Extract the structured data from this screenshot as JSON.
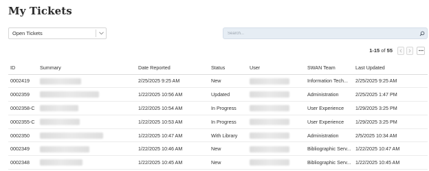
{
  "page": {
    "title": "My Tickets"
  },
  "filter": {
    "selected": "Open Tickets",
    "icon": "chevron-down-icon"
  },
  "search": {
    "placeholder": "Search...",
    "value": "",
    "icon": "search-icon"
  },
  "pager": {
    "range": "1-15",
    "of_word": "of",
    "total": "55"
  },
  "table": {
    "columns": [
      "ID",
      "Summary",
      "Date Reported",
      "Status",
      "User",
      "SWAN Team",
      "Last Updated"
    ],
    "rows": [
      {
        "id": "0002419",
        "date_reported": "2/25/2025 9:25 AM",
        "status": "New",
        "team": "Information Tech...",
        "last_updated": "2/25/2025 9:25 AM"
      },
      {
        "id": "0002359",
        "date_reported": "1/22/2025 10:56 AM",
        "status": "Updated",
        "team": "Administration",
        "last_updated": "2/25/2025 1:47 PM"
      },
      {
        "id": "0002358-C",
        "date_reported": "1/22/2025 10:54 AM",
        "status": "In Progress",
        "team": "User Experience",
        "last_updated": "1/29/2025 3:25 PM"
      },
      {
        "id": "0002355-C",
        "date_reported": "1/22/2025 10:53 AM",
        "status": "In Progress",
        "team": "User Experience",
        "last_updated": "1/29/2025 3:25 PM"
      },
      {
        "id": "0002350",
        "date_reported": "1/22/2025 10:47 AM",
        "status": "With Library",
        "team": "Administration",
        "last_updated": "2/5/2025 10:34 AM"
      },
      {
        "id": "0002349",
        "date_reported": "1/22/2025 10:46 AM",
        "status": "New",
        "team": "Bibliographic Serv...",
        "last_updated": "1/22/2025 10:47 AM"
      },
      {
        "id": "0002348",
        "date_reported": "1/22/2025 10:45 AM",
        "status": "New",
        "team": "Bibliographic Serv...",
        "last_updated": "1/22/2025 10:45 AM"
      }
    ]
  }
}
